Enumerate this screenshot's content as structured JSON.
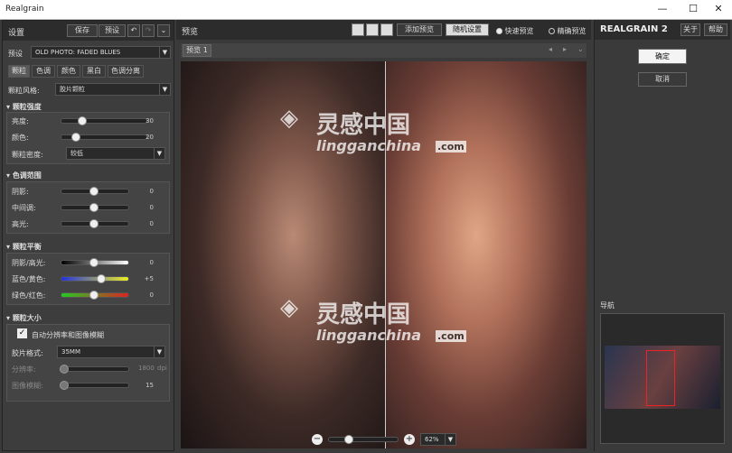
{
  "window": {
    "title": "Realgrain",
    "min": "—",
    "max": "☐",
    "close": "✕"
  },
  "left": {
    "title": "设置",
    "save": "保存",
    "preset_btn": "预设",
    "preset_label": "预设",
    "preset_value": "OLD PHOTO: FADED BLUES",
    "tabs": [
      "颗粒",
      "色调",
      "颜色",
      "黑白",
      "色调分离"
    ],
    "grain_style_label": "颗粒风格:",
    "grain_style_value": "胶片颗粒",
    "intensity": {
      "title": "颗粒强度",
      "rows": [
        {
          "label": "亮度:",
          "value": "30",
          "pos": 0.37
        },
        {
          "label": "颜色:",
          "value": "20",
          "pos": 0.25
        }
      ],
      "density_label": "颗粒密度:",
      "density_value": "较低"
    },
    "tonal": {
      "title": "色调范围",
      "rows": [
        {
          "label": "阴影:",
          "value": "0",
          "pos": 0.5
        },
        {
          "label": "中间调:",
          "value": "0",
          "pos": 0.5
        },
        {
          "label": "高光:",
          "value": "0",
          "pos": 0.5
        }
      ]
    },
    "balance": {
      "title": "颗粒平衡",
      "rows": [
        {
          "label": "阴影/高光:",
          "value": "0",
          "pos": 0.5
        },
        {
          "label": "蓝色/黄色:",
          "value": "+5",
          "pos": 0.6
        },
        {
          "label": "绿色/红色:",
          "value": "0",
          "pos": 0.5
        }
      ]
    },
    "size": {
      "title": "颗粒大小",
      "auto_label": "自动分辨率和图像模糊",
      "format_label": "胶片格式:",
      "format_value": "35MM",
      "res_label": "分辨率:",
      "res_value": "1800",
      "res_unit": "dpi",
      "blur_label": "图像模糊:",
      "blur_value": "15"
    }
  },
  "center": {
    "title": "预览",
    "add_preview": "添加预览",
    "random": "随机设置",
    "fast": "快速预览",
    "accurate": "精确预览",
    "tab": "预览 1",
    "zoom": "62%",
    "wm_brand": "灵感中国",
    "wm_url": "lingganchina",
    "wm_com": ".com"
  },
  "right": {
    "brand": "REALGRAIN 2",
    "about": "关于",
    "help": "帮助",
    "ok": "确定",
    "cancel": "取消",
    "nav": "导航"
  }
}
